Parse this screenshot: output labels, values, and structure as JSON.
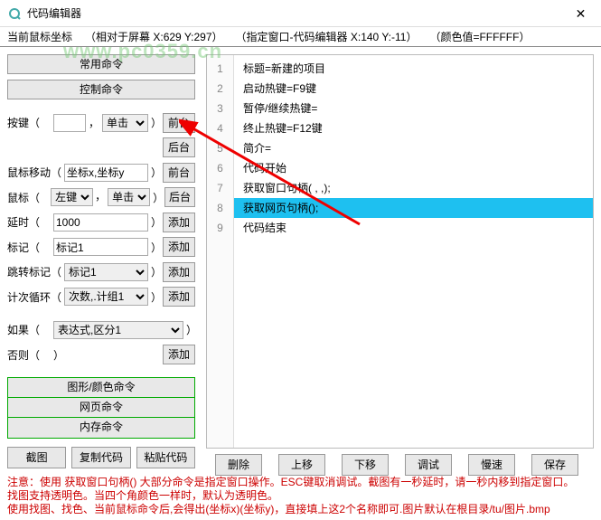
{
  "window": {
    "title": "代码编辑器"
  },
  "status": {
    "label": "当前鼠标坐标",
    "screen": "（相对于屏幕 X:629 Y:297）",
    "window": "（指定窗口-代码编辑器 X:140 Y:-11）",
    "color": "（颜色值=FFFFFF）"
  },
  "watermark": "www.pc0359.cn",
  "left": {
    "common_cmd": "常用命令",
    "control_cmd": "控制命令",
    "key_label": "按键（",
    "key_value": "",
    "key_click_options": [
      "单击"
    ],
    "foreground": "前台",
    "background": "后台",
    "mouse_move_label": "鼠标移动（",
    "mouse_move_value": "坐标x,坐标y",
    "mouse_label": "鼠标（",
    "mouse_btn_options": [
      "左键"
    ],
    "mouse_click_options": [
      "单击"
    ],
    "delay_label": "延时（",
    "delay_value": "1000",
    "add": "添加",
    "mark_label": "标记（",
    "mark_value": "标记1",
    "jump_label": "跳转标记（",
    "jump_value": "标记1",
    "loop_label": "计次循环（",
    "loop_value": "次数,.计组1",
    "if_label": "如果（",
    "if_value": "表达式,区分1",
    "else_label": "否则（",
    "shape_cmd": "图形/颜色命令",
    "web_cmd": "网页命令",
    "mem_cmd": "内存命令",
    "screenshot": "截图",
    "copy_code": "复制代码",
    "paste_code": "粘贴代码"
  },
  "code": {
    "lines": [
      "标题=新建的项目",
      "启动热键=F9键",
      "暂停/继续热键=",
      "终止热键=F12键",
      "简介=",
      "代码开始",
      "获取窗口句柄(                                ,                                ,);",
      "获取网页句柄();",
      "代码结束"
    ],
    "selected_index": 7
  },
  "right_btns": {
    "delete": "删除",
    "up": "上移",
    "down": "下移",
    "debug": "调试",
    "slow": "慢速",
    "save": "保存"
  },
  "footer": {
    "l1": "注意：使用 获取窗口句柄() 大部分命令是指定窗口操作。ESC键取消调试。截图有一秒延时，请一秒内移到指定窗口。",
    "l2": "找图支持透明色。当四个角颜色一样时，默认为透明色。",
    "l3": "使用找图、找色、当前鼠标命令后,会得出(坐标x)(坐标y)，直接填上这2个名称即可.图片默认在根目录/tu/图片.bmp"
  }
}
